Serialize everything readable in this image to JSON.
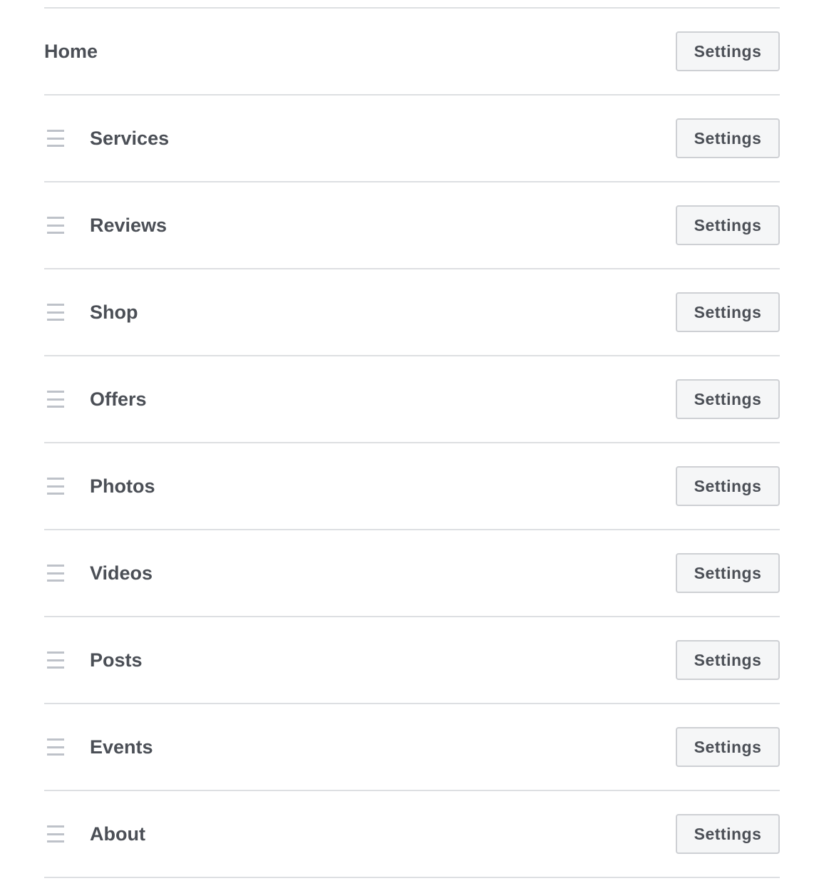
{
  "tabs": [
    {
      "label": "Home",
      "draggable": false,
      "button_label": "Settings"
    },
    {
      "label": "Services",
      "draggable": true,
      "button_label": "Settings"
    },
    {
      "label": "Reviews",
      "draggable": true,
      "button_label": "Settings"
    },
    {
      "label": "Shop",
      "draggable": true,
      "button_label": "Settings"
    },
    {
      "label": "Offers",
      "draggable": true,
      "button_label": "Settings"
    },
    {
      "label": "Photos",
      "draggable": true,
      "button_label": "Settings"
    },
    {
      "label": "Videos",
      "draggable": true,
      "button_label": "Settings"
    },
    {
      "label": "Posts",
      "draggable": true,
      "button_label": "Settings"
    },
    {
      "label": "Events",
      "draggable": true,
      "button_label": "Settings"
    },
    {
      "label": "About",
      "draggable": true,
      "button_label": "Settings"
    }
  ],
  "icons": {
    "handle": "drag-handle-icon"
  },
  "colors": {
    "text": "#4b4f56",
    "divider": "#dddfe2",
    "button_bg": "#f5f6f7",
    "handle": "#bec2c9"
  }
}
